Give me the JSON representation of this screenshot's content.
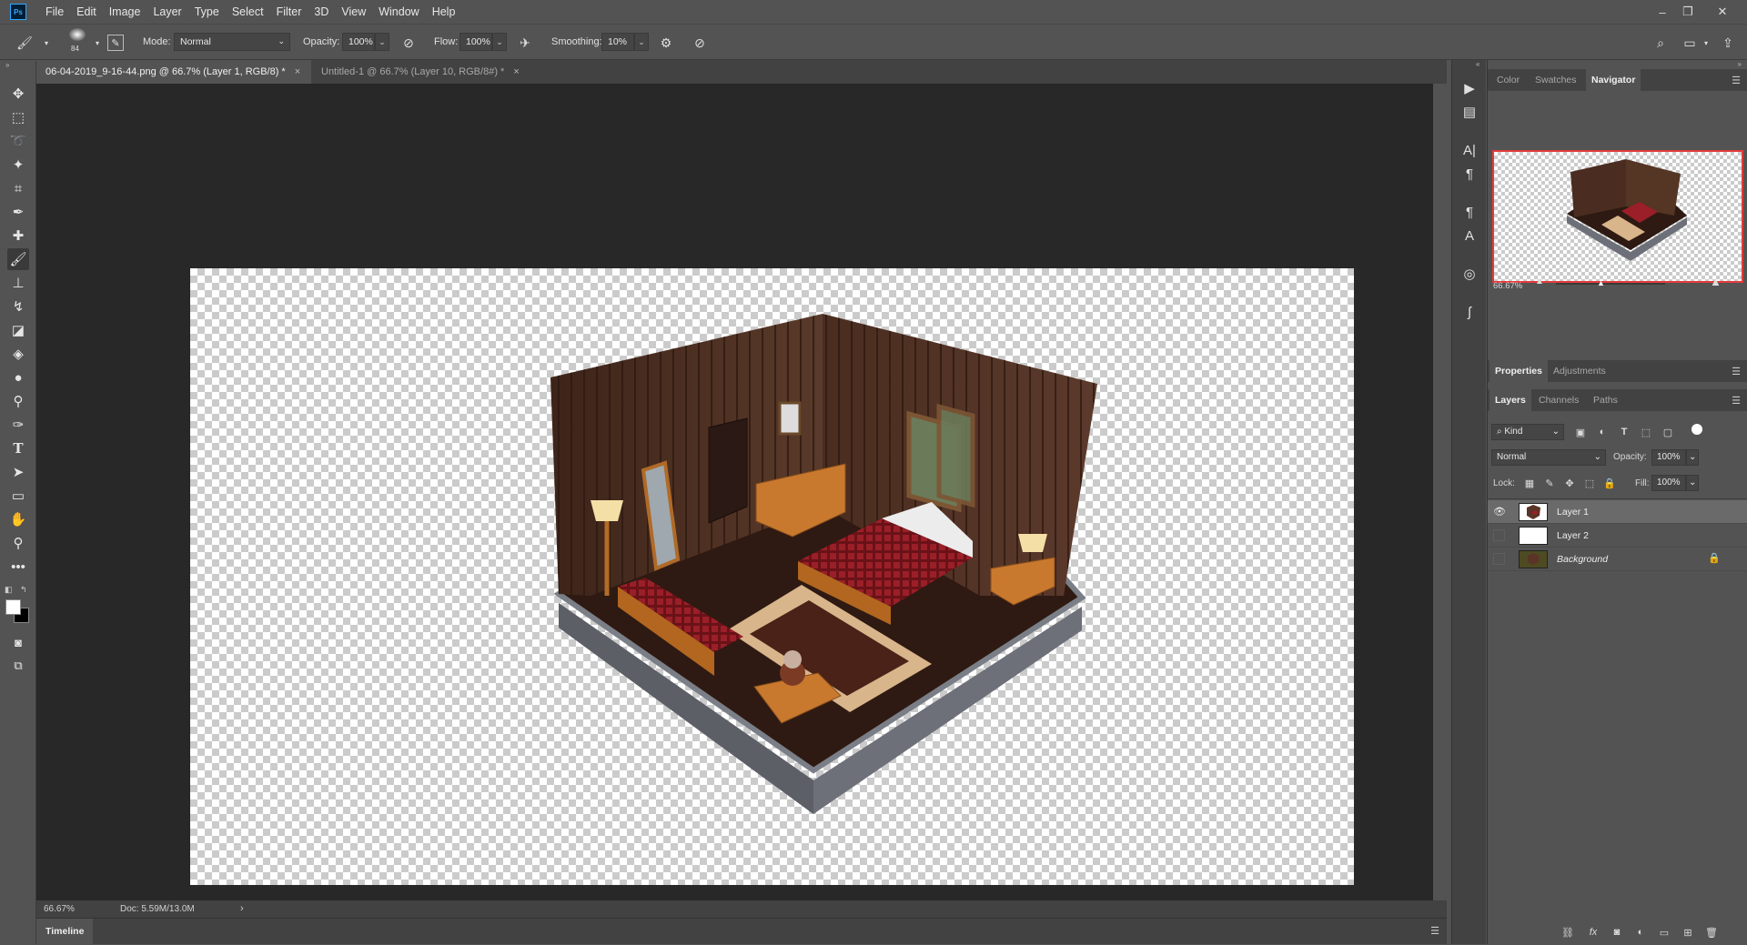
{
  "app": {
    "logo_text": "Ps"
  },
  "menu": [
    "File",
    "Edit",
    "Image",
    "Layer",
    "Type",
    "Select",
    "Filter",
    "3D",
    "View",
    "Window",
    "Help"
  ],
  "options": {
    "brush_size": "84",
    "mode_label": "Mode:",
    "mode_value": "Normal",
    "opacity_label": "Opacity:",
    "opacity_value": "100%",
    "flow_label": "Flow:",
    "flow_value": "100%",
    "smoothing_label": "Smoothing:",
    "smoothing_value": "10%"
  },
  "tabs": [
    {
      "label": "06-04-2019_9-16-44.png @ 66.7% (Layer 1, RGB/8) *",
      "close": "×"
    },
    {
      "label": "Untitled-1 @ 66.7% (Layer 10, RGB/8#) *",
      "close": "×"
    }
  ],
  "status": {
    "zoom": "66.67%",
    "doc": "Doc: 5.59M/13.0M",
    "arrow": "›"
  },
  "timeline": {
    "label": "Timeline"
  },
  "navigator": {
    "tabs": [
      "Color",
      "Swatches",
      "Navigator"
    ],
    "zoom": "66.67%"
  },
  "properties": {
    "tabs": [
      "Properties",
      "Adjustments"
    ]
  },
  "layers": {
    "tabs": [
      "Layers",
      "Channels",
      "Paths"
    ],
    "kind_filter": "Kind",
    "blend_mode": "Normal",
    "opacity_label": "Opacity:",
    "opacity_value": "100%",
    "lock_label": "Lock:",
    "fill_label": "Fill:",
    "fill_value": "100%",
    "items": [
      {
        "name": "Layer 1",
        "visible": true,
        "selected": true
      },
      {
        "name": "Layer 2",
        "visible": false,
        "selected": false
      },
      {
        "name": "Background",
        "visible": false,
        "selected": false,
        "locked": true
      }
    ]
  },
  "colors": {
    "ui_bg": "#535353",
    "canvas_bg": "#282828",
    "accent_red": "#e23b3b",
    "wood_dark": "#3a2418",
    "bed_red": "#8d1c24"
  }
}
